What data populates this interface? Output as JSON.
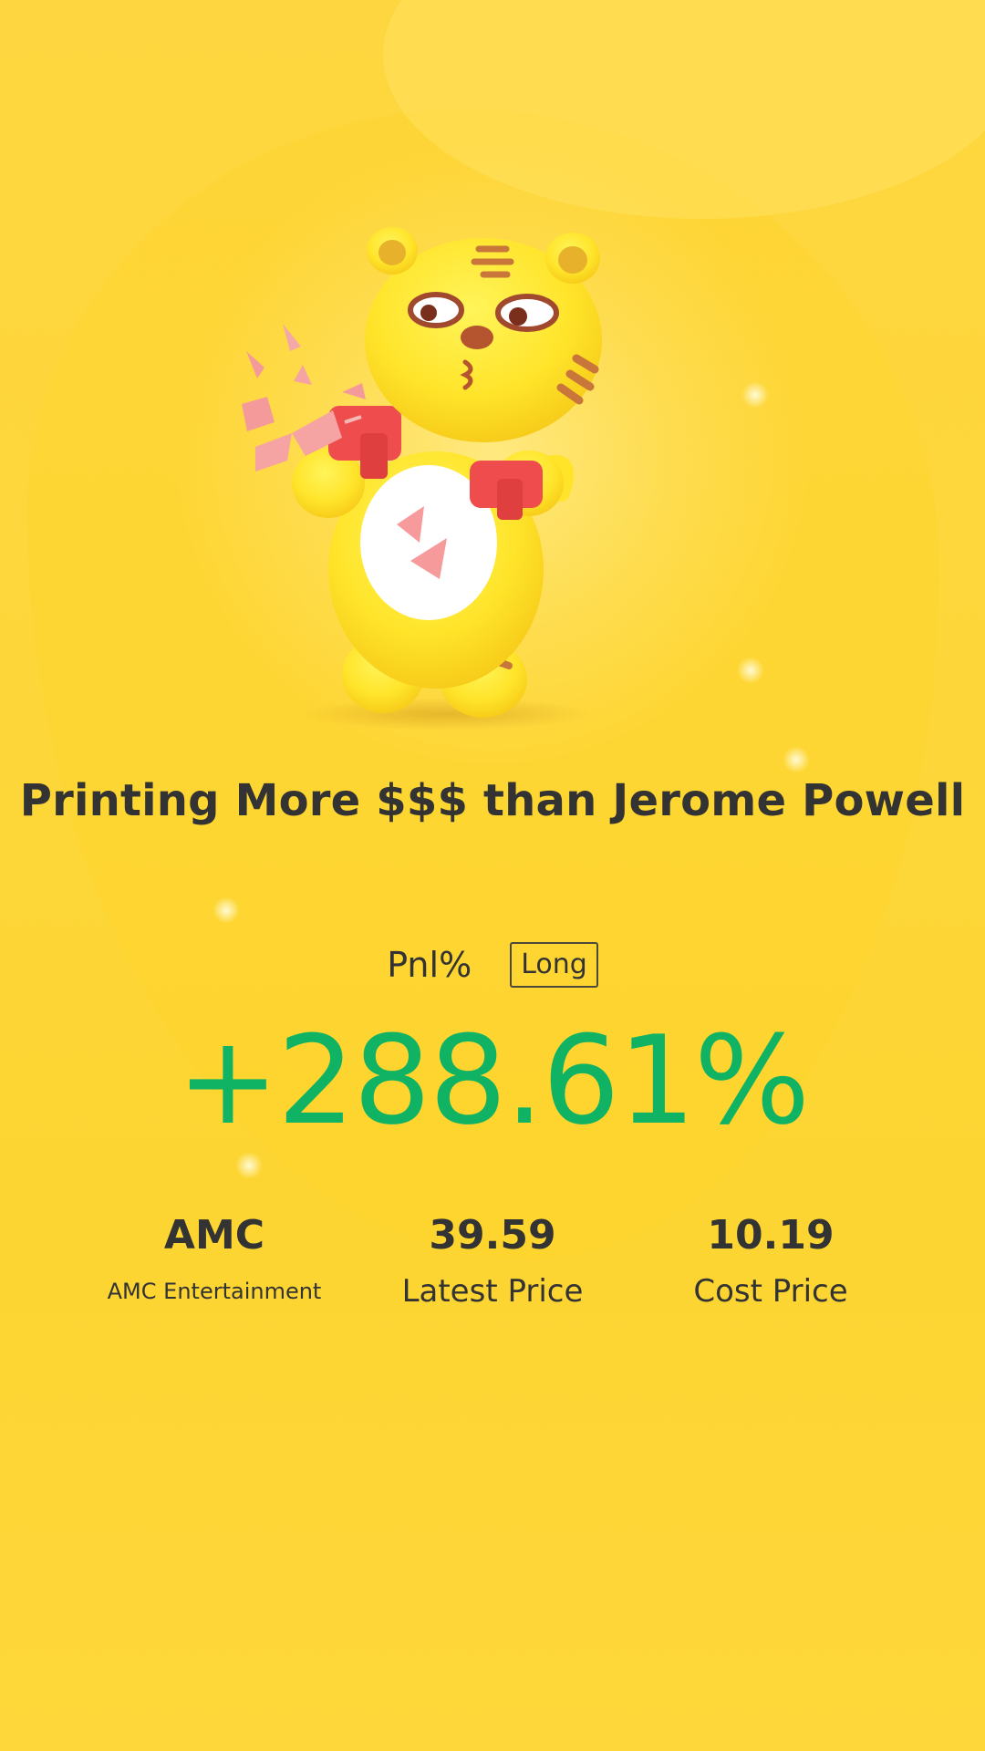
{
  "headline": "Printing More $$$ than Jerome Powell",
  "pnl": {
    "label": "Pnl%",
    "side": "Long",
    "value": "+288.61%"
  },
  "stats": {
    "ticker": {
      "value": "AMC",
      "label": "AMC Entertainment"
    },
    "latest": {
      "value": "39.59",
      "label": "Latest Price"
    },
    "cost": {
      "value": "10.19",
      "label": "Cost Price"
    }
  },
  "colors": {
    "background": "#fdd73a",
    "positive": "#0fb363",
    "text": "#333333"
  },
  "illustration": "tiger-mascot-money-guns"
}
